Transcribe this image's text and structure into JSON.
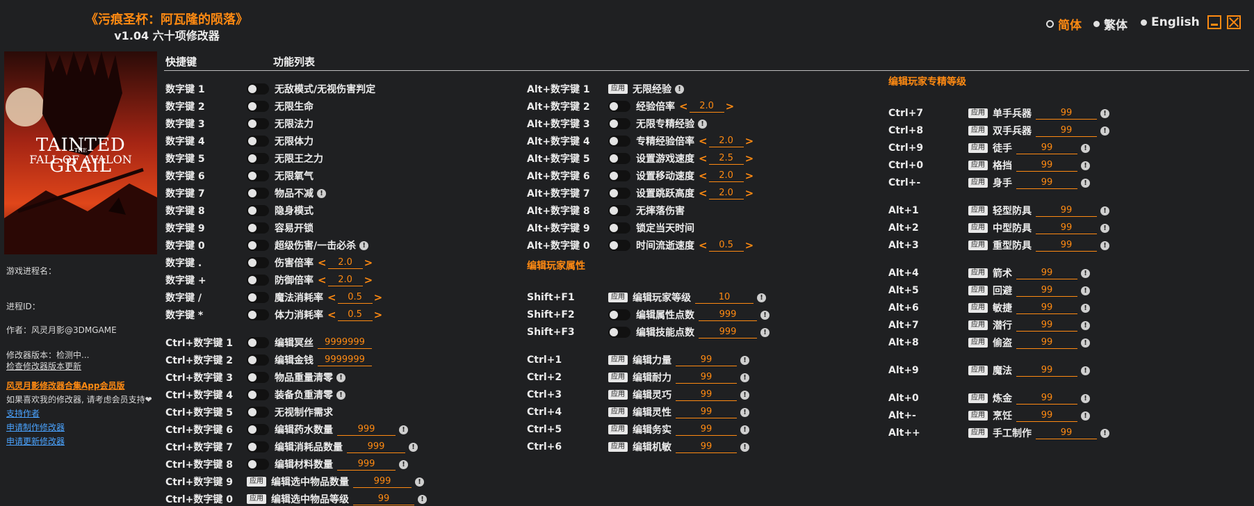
{
  "header": {
    "title": "《污痕圣杯：阿瓦隆的陨落》",
    "subtitle": "v1.04 六十项修改器"
  },
  "languages": [
    {
      "label": "简体",
      "selected": true
    },
    {
      "label": "繁体",
      "selected": false
    },
    {
      "label": "English",
      "selected": false
    }
  ],
  "cover": {
    "line1": "TAINTED GRAIL",
    "the": "THE",
    "line2": "FALL OF AVALON"
  },
  "sidebar": {
    "process_name": "游戏进程名：",
    "process_id": "进程ID：",
    "author": "作者：风灵月影@3DMGAME",
    "version": "修改器版本：检测中...",
    "check_update": "检查修改器版本更新",
    "app_link": "风灵月影修改器合集App会员版",
    "support_text": "如果喜欢我的修改器, 请考虑会员支持❤",
    "support_link": "支持作者",
    "request_make": "申请制作修改器",
    "request_update": "申请更新修改器"
  },
  "columns": {
    "hotkey": "快捷键",
    "features": "功能列表"
  },
  "sections": {
    "player_attr": "编辑玩家属性",
    "mastery": "编辑玩家专精等级"
  },
  "col1": [
    {
      "key": "数字键 1",
      "type": "toggle",
      "label": "无敌模式/无视伤害判定"
    },
    {
      "key": "数字键 2",
      "type": "toggle",
      "label": "无限生命"
    },
    {
      "key": "数字键 3",
      "type": "toggle",
      "label": "无限法力"
    },
    {
      "key": "数字键 4",
      "type": "toggle",
      "label": "无限体力"
    },
    {
      "key": "数字键 5",
      "type": "toggle",
      "label": "无限王之力"
    },
    {
      "key": "数字键 6",
      "type": "toggle",
      "label": "无限氧气"
    },
    {
      "key": "数字键 7",
      "type": "toggle",
      "label": "物品不减",
      "info": true
    },
    {
      "key": "数字键 8",
      "type": "toggle",
      "label": "隐身模式"
    },
    {
      "key": "数字键 9",
      "type": "toggle",
      "label": "容易开锁"
    },
    {
      "key": "数字键 0",
      "type": "toggle",
      "label": "超级伤害/一击必杀",
      "info": true
    },
    {
      "key": "数字键 .",
      "type": "toggle",
      "label": "伤害倍率",
      "stepper": "2.0"
    },
    {
      "key": "数字键 +",
      "type": "toggle",
      "label": "防御倍率",
      "stepper": "2.0"
    },
    {
      "key": "数字键 /",
      "type": "toggle",
      "label": "魔法消耗率",
      "stepper": "0.5"
    },
    {
      "key": "数字键 *",
      "type": "toggle",
      "label": "体力消耗率",
      "stepper": "0.5"
    },
    {
      "key": "Ctrl+数字键 1",
      "type": "toggle",
      "label": "编辑冥丝",
      "value": "9999999"
    },
    {
      "key": "Ctrl+数字键 2",
      "type": "toggle",
      "label": "编辑金钱",
      "value": "9999999"
    },
    {
      "key": "Ctrl+数字键 3",
      "type": "toggle",
      "label": "物品重量清零",
      "info": true
    },
    {
      "key": "Ctrl+数字键 4",
      "type": "toggle",
      "label": "装备负重清零",
      "info": true
    },
    {
      "key": "Ctrl+数字键 5",
      "type": "toggle",
      "label": "无视制作需求"
    },
    {
      "key": "Ctrl+数字键 6",
      "type": "toggle",
      "label": "编辑药水数量",
      "value": "999",
      "info": true
    },
    {
      "key": "Ctrl+数字键 7",
      "type": "toggle",
      "label": "编辑消耗品数量",
      "value": "999",
      "info": true
    },
    {
      "key": "Ctrl+数字键 8",
      "type": "toggle",
      "label": "编辑材料数量",
      "value": "999",
      "info": true
    },
    {
      "key": "Ctrl+数字键 9",
      "type": "apply",
      "label": "编辑选中物品数量",
      "value": "999",
      "info": true
    },
    {
      "key": "Ctrl+数字键 0",
      "type": "apply",
      "label": "编辑选中物品等级",
      "value": "99",
      "info": true
    }
  ],
  "col2": [
    {
      "key": "Alt+数字键 1",
      "type": "apply",
      "label": "无限经验",
      "info": true
    },
    {
      "key": "Alt+数字键 2",
      "type": "toggle",
      "label": "经验倍率",
      "stepper": "2.0"
    },
    {
      "key": "Alt+数字键 3",
      "type": "toggle",
      "label": "无限专精经验",
      "info": true
    },
    {
      "key": "Alt+数字键 4",
      "type": "toggle",
      "label": "专精经验倍率",
      "stepper": "2.0"
    },
    {
      "key": "Alt+数字键 5",
      "type": "toggle",
      "label": "设置游戏速度",
      "stepper": "2.5"
    },
    {
      "key": "Alt+数字键 6",
      "type": "toggle",
      "label": "设置移动速度",
      "stepper": "2.0"
    },
    {
      "key": "Alt+数字键 7",
      "type": "toggle",
      "label": "设置跳跃高度",
      "stepper": "2.0"
    },
    {
      "key": "Alt+数字键 8",
      "type": "toggle",
      "label": "无摔落伤害"
    },
    {
      "key": "Alt+数字键 9",
      "type": "toggle",
      "label": "锁定当天时间"
    },
    {
      "key": "Alt+数字键 0",
      "type": "toggle",
      "label": "时间流逝速度",
      "stepper": "0.5"
    },
    {
      "key": "Shift+F1",
      "type": "apply",
      "label": "编辑玩家等级",
      "value": "10",
      "info": true
    },
    {
      "key": "Shift+F2",
      "type": "toggle",
      "label": "编辑属性点数",
      "value": "999",
      "info": true
    },
    {
      "key": "Shift+F3",
      "type": "toggle",
      "label": "编辑技能点数",
      "value": "999",
      "info": true
    },
    {
      "key": "Ctrl+1",
      "type": "apply",
      "label": "编辑力量",
      "value": "99",
      "info": true
    },
    {
      "key": "Ctrl+2",
      "type": "apply",
      "label": "编辑耐力",
      "value": "99",
      "info": true
    },
    {
      "key": "Ctrl+3",
      "type": "apply",
      "label": "编辑灵巧",
      "value": "99",
      "info": true
    },
    {
      "key": "Ctrl+4",
      "type": "apply",
      "label": "编辑灵性",
      "value": "99",
      "info": true
    },
    {
      "key": "Ctrl+5",
      "type": "apply",
      "label": "编辑务实",
      "value": "99",
      "info": true
    },
    {
      "key": "Ctrl+6",
      "type": "apply",
      "label": "编辑机敏",
      "value": "99",
      "info": true
    }
  ],
  "col3": [
    {
      "key": "Ctrl+7",
      "type": "apply",
      "label": "单手兵器",
      "value": "99",
      "info": true
    },
    {
      "key": "Ctrl+8",
      "type": "apply",
      "label": "双手兵器",
      "value": "99",
      "info": true
    },
    {
      "key": "Ctrl+9",
      "type": "apply",
      "label": "徒手",
      "value": "99",
      "info": true
    },
    {
      "key": "Ctrl+0",
      "type": "apply",
      "label": "格挡",
      "value": "99",
      "info": true
    },
    {
      "key": "Ctrl+-",
      "type": "apply",
      "label": "身手",
      "value": "99",
      "info": true
    },
    {
      "key": "Alt+1",
      "type": "apply",
      "label": "轻型防具",
      "value": "99",
      "info": true
    },
    {
      "key": "Alt+2",
      "type": "apply",
      "label": "中型防具",
      "value": "99",
      "info": true
    },
    {
      "key": "Alt+3",
      "type": "apply",
      "label": "重型防具",
      "value": "99",
      "info": true
    },
    {
      "key": "Alt+4",
      "type": "apply",
      "label": "箭术",
      "value": "99",
      "info": true
    },
    {
      "key": "Alt+5",
      "type": "apply",
      "label": "回避",
      "value": "99",
      "info": true
    },
    {
      "key": "Alt+6",
      "type": "apply",
      "label": "敏捷",
      "value": "99",
      "info": true
    },
    {
      "key": "Alt+7",
      "type": "apply",
      "label": "潜行",
      "value": "99",
      "info": true
    },
    {
      "key": "Alt+8",
      "type": "apply",
      "label": "偷盗",
      "value": "99",
      "info": true
    },
    {
      "key": "Alt+9",
      "type": "apply",
      "label": "魔法",
      "value": "99",
      "info": true
    },
    {
      "key": "Alt+0",
      "type": "apply",
      "label": "炼金",
      "value": "99",
      "info": true
    },
    {
      "key": "Alt+-",
      "type": "apply",
      "label": "烹饪",
      "value": "99",
      "info": true
    },
    {
      "key": "Alt++",
      "type": "apply",
      "label": "手工制作",
      "value": "99",
      "info": true
    }
  ],
  "ui": {
    "apply_label": "应用",
    "arrow_left": "<",
    "arrow_right": ">",
    "info_glyph": "!"
  },
  "colors": {
    "accent": "#ff8a12",
    "background": "#1f2022",
    "text": "#e8e8e8"
  }
}
